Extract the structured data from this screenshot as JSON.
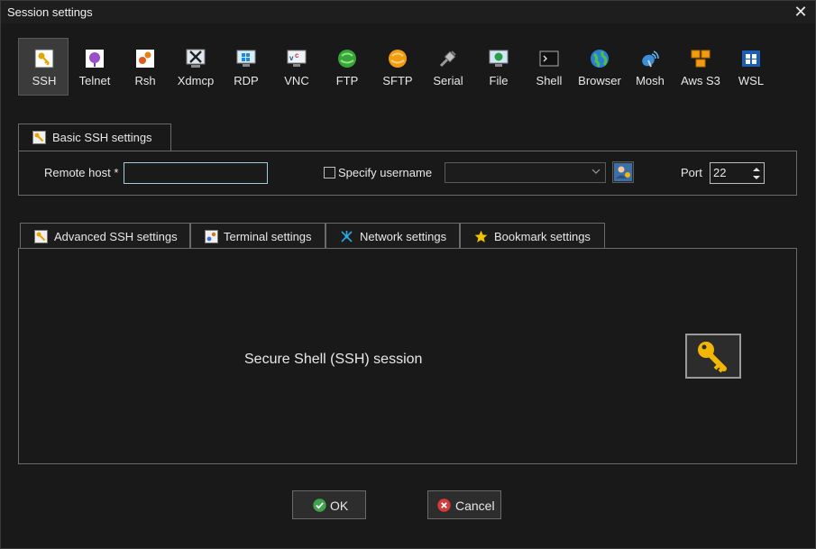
{
  "window": {
    "title": "Session settings"
  },
  "session_types": [
    {
      "label": "SSH",
      "icon": "ssh-key-icon",
      "active": true
    },
    {
      "label": "Telnet",
      "icon": "telnet-icon"
    },
    {
      "label": "Rsh",
      "icon": "rsh-icon"
    },
    {
      "label": "Xdmcp",
      "icon": "xdmcp-icon"
    },
    {
      "label": "RDP",
      "icon": "rdp-icon"
    },
    {
      "label": "VNC",
      "icon": "vnc-icon"
    },
    {
      "label": "FTP",
      "icon": "ftp-icon"
    },
    {
      "label": "SFTP",
      "icon": "sftp-icon"
    },
    {
      "label": "Serial",
      "icon": "serial-icon"
    },
    {
      "label": "File",
      "icon": "file-icon"
    },
    {
      "label": "Shell",
      "icon": "shell-icon"
    },
    {
      "label": "Browser",
      "icon": "browser-icon"
    },
    {
      "label": "Mosh",
      "icon": "mosh-icon"
    },
    {
      "label": "Aws S3",
      "icon": "aws-s3-icon"
    },
    {
      "label": "WSL",
      "icon": "wsl-icon"
    }
  ],
  "basic": {
    "tab_label": "Basic SSH settings",
    "remote_host_label": "Remote host *",
    "remote_host_value": "",
    "specify_username_label": "Specify username",
    "specify_username_checked": false,
    "username_value": "",
    "port_label": "Port",
    "port_value": "22"
  },
  "advanced_tabs": [
    {
      "label": "Advanced SSH settings",
      "icon": "wrench-icon"
    },
    {
      "label": "Terminal settings",
      "icon": "terminal-icon"
    },
    {
      "label": "Network settings",
      "icon": "network-icon"
    },
    {
      "label": "Bookmark settings",
      "icon": "star-icon"
    }
  ],
  "panel": {
    "description": "Secure Shell (SSH) session"
  },
  "buttons": {
    "ok": "OK",
    "cancel": "Cancel"
  },
  "colors": {
    "accent_active_bg": "#3b3b3b",
    "ok_green": "#3fa34d",
    "cancel_red": "#d63a3a",
    "key_gold": "#f2b705"
  }
}
